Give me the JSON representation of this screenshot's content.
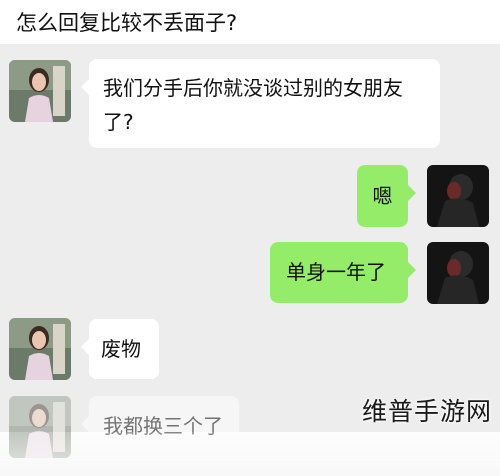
{
  "question": "怎么回复比较不丢面子?",
  "colors": {
    "chat_background": "#ededed",
    "incoming_bubble": "#ffffff",
    "outgoing_bubble": "#95ec69"
  },
  "messages": [
    {
      "side": "incoming",
      "text": "我们分手后你就没谈过别的女朋友了?"
    },
    {
      "side": "outgoing",
      "text": "嗯"
    },
    {
      "side": "outgoing",
      "text": "单身一年了"
    },
    {
      "side": "incoming",
      "text": "废物"
    },
    {
      "side": "incoming",
      "text": "我都换三个了"
    }
  ],
  "watermark": "维普手游网"
}
